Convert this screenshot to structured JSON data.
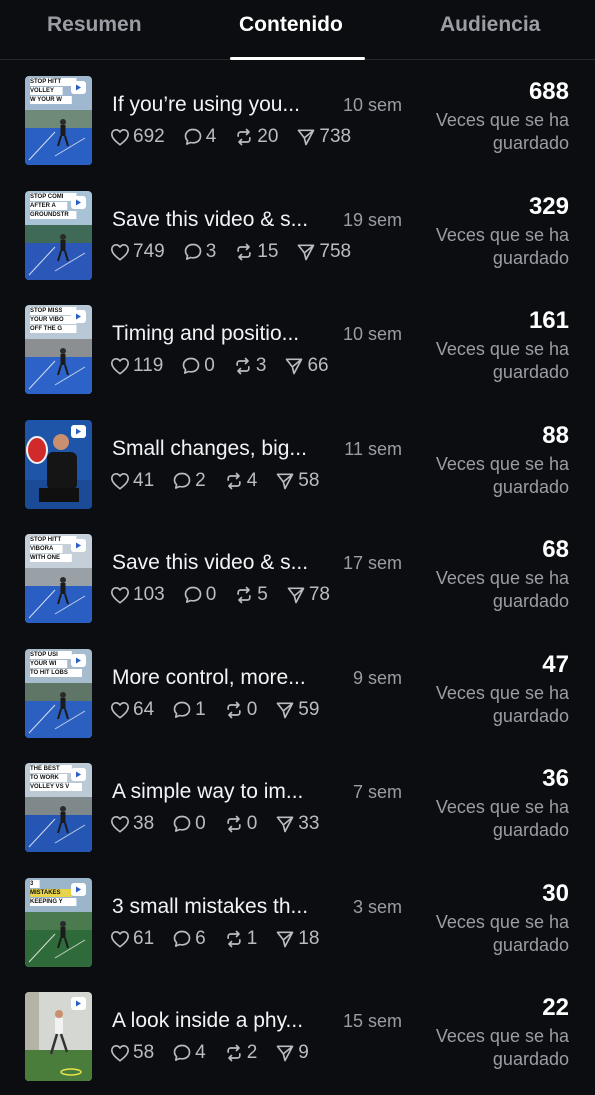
{
  "tabs": [
    {
      "label": "Resumen",
      "active": false
    },
    {
      "label": "Contenido",
      "active": true
    },
    {
      "label": "Audiencia",
      "active": false
    }
  ],
  "saves_label": "Veces que se ha guardado",
  "icons": {
    "likes": "heart-icon",
    "comments": "comment-icon",
    "reposts": "repost-icon",
    "shares": "share-icon",
    "thumbnail_badge": "play-icon"
  },
  "posts": [
    {
      "thumb_text": [
        "STOP HITT",
        "VOLLEY",
        "W YOUR W"
      ],
      "title": "If you’re using you...",
      "age": "10 sem",
      "likes": "692",
      "comments": "4",
      "reposts": "20",
      "shares": "738",
      "saves": "688"
    },
    {
      "thumb_text": [
        "STOP COMI",
        "AFTER A",
        "GROUNDSTR"
      ],
      "title": "Save this video & s...",
      "age": "19 sem",
      "likes": "749",
      "comments": "3",
      "reposts": "15",
      "shares": "758",
      "saves": "329"
    },
    {
      "thumb_text": [
        "STOP MISS",
        "YOUR VIBO",
        "OFF THE G"
      ],
      "title": "Timing and positio...",
      "age": "10 sem",
      "likes": "119",
      "comments": "0",
      "reposts": "3",
      "shares": "66",
      "saves": "161"
    },
    {
      "thumb_text": [],
      "title": "Small changes, big...",
      "age": "11 sem",
      "likes": "41",
      "comments": "2",
      "reposts": "4",
      "shares": "58",
      "saves": "88"
    },
    {
      "thumb_text": [
        "STOP HITT",
        "VIBORA",
        "WITH ONE"
      ],
      "title": "Save this video & s...",
      "age": "17 sem",
      "likes": "103",
      "comments": "0",
      "reposts": "5",
      "shares": "78",
      "saves": "68"
    },
    {
      "thumb_text": [
        "STOP USI",
        "YOUR WI",
        "TO HIT LOBS"
      ],
      "title": "More control, more...",
      "age": "9 sem",
      "likes": "64",
      "comments": "1",
      "reposts": "0",
      "shares": "59",
      "saves": "47"
    },
    {
      "thumb_text": [
        "THE BEST",
        "TO WORK",
        "VOLLEY VS V"
      ],
      "title": "A simple way to im...",
      "age": "7 sem",
      "likes": "38",
      "comments": "0",
      "reposts": "0",
      "shares": "33",
      "saves": "36"
    },
    {
      "thumb_text": [
        "3",
        "MISTAKES",
        "KEEPING Y"
      ],
      "title": "3 small mistakes th...",
      "age": "3 sem",
      "likes": "61",
      "comments": "6",
      "reposts": "1",
      "shares": "18",
      "saves": "30"
    },
    {
      "thumb_text": [],
      "title": "A look inside a phy...",
      "age": "15 sem",
      "likes": "58",
      "comments": "4",
      "reposts": "2",
      "shares": "9",
      "saves": "22"
    }
  ]
}
